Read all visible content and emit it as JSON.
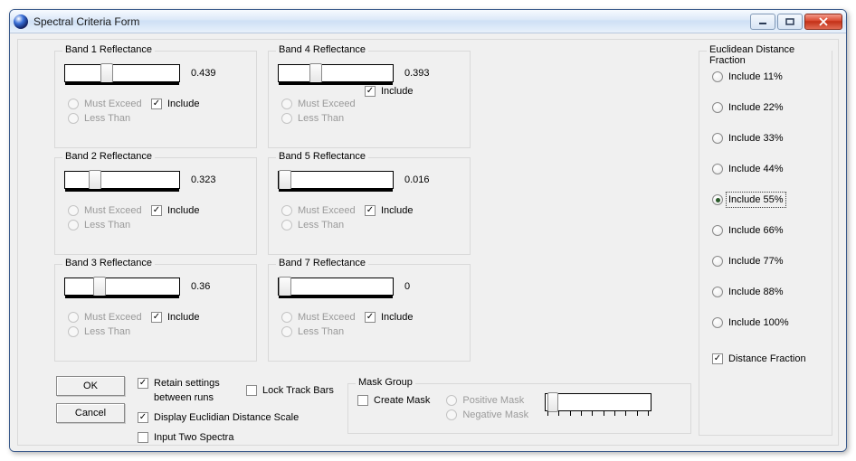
{
  "window": {
    "title": "Spectral Criteria Form"
  },
  "bands": [
    {
      "legend": "Band 1 Reflectance",
      "value": "0.439",
      "thumb_pct": 34,
      "must_exceed": "Must Exceed",
      "less_than": "Less Than",
      "include": "Include",
      "include_checked": true
    },
    {
      "legend": "Band 2 Reflectance",
      "value": "0.323",
      "thumb_pct": 23,
      "must_exceed": "Must Exceed",
      "less_than": "Less Than",
      "include": "Include",
      "include_checked": true
    },
    {
      "legend": "Band 3 Reflectance",
      "value": "0.36",
      "thumb_pct": 27,
      "must_exceed": "Must Exceed",
      "less_than": "Less Than",
      "include": "Include",
      "include_checked": true
    },
    {
      "legend": "Band 4 Reflectance",
      "value": "0.393",
      "thumb_pct": 30,
      "must_exceed": "Must Exceed",
      "less_than": "Less Than",
      "include": "Include",
      "include_checked": true
    },
    {
      "legend": "Band 5 Reflectance",
      "value": "0.016",
      "thumb_pct": 0,
      "must_exceed": "Must Exceed",
      "less_than": "Less Than",
      "include": "Include",
      "include_checked": true
    },
    {
      "legend": "Band 7 Reflectance",
      "value": "0",
      "thumb_pct": 0,
      "must_exceed": "Must Exceed",
      "less_than": "Less Than",
      "include": "Include",
      "include_checked": true
    }
  ],
  "buttons": {
    "ok": "OK",
    "cancel": "Cancel"
  },
  "lower": {
    "retain": "Retain settings between runs",
    "retain_checked": true,
    "lock": "Lock Track Bars",
    "lock_checked": false,
    "display_scale": "Display Euclidian Distance Scale",
    "display_scale_checked": true,
    "input_two": "Input Two Spectra",
    "input_two_checked": false
  },
  "mask": {
    "legend": "Mask Group",
    "create": "Create Mask",
    "create_checked": false,
    "positive": "Positive Mask",
    "negative": "Negative Mask"
  },
  "right": {
    "legend": "Euclidean Distance Fraction",
    "options": [
      "Include 11%",
      "Include 22%",
      "Include 33%",
      "Include 44%",
      "Include 55%",
      "Include 66%",
      "Include 77%",
      "Include 88%",
      "Include 100%"
    ],
    "selected_index": 4,
    "df_label": "Distance Fraction",
    "df_checked": true
  }
}
